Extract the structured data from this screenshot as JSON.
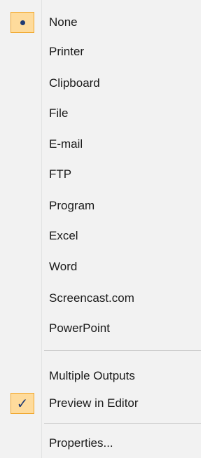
{
  "menu": {
    "destinations": [
      {
        "label": "None",
        "selected": true
      },
      {
        "label": "Printer",
        "selected": false
      },
      {
        "label": "Clipboard",
        "selected": false
      },
      {
        "label": "File",
        "selected": false
      },
      {
        "label": "E-mail",
        "selected": false
      },
      {
        "label": "FTP",
        "selected": false
      },
      {
        "label": "Program",
        "selected": false
      },
      {
        "label": "Excel",
        "selected": false
      },
      {
        "label": "Word",
        "selected": false
      },
      {
        "label": "Screencast.com",
        "selected": false
      },
      {
        "label": "PowerPoint",
        "selected": false
      }
    ],
    "options": [
      {
        "label": "Multiple Outputs",
        "checked": false
      },
      {
        "label": "Preview in Editor",
        "checked": true
      }
    ],
    "properties_label": "Properties...",
    "check_glyph": "✓",
    "colors": {
      "highlight_fill": "#fedb9c",
      "highlight_border": "#f0a830",
      "glyph": "#1f3a73"
    },
    "icons": {
      "selected_marker": "radio-bullet-icon",
      "checked_marker": "checkmark-icon"
    }
  }
}
